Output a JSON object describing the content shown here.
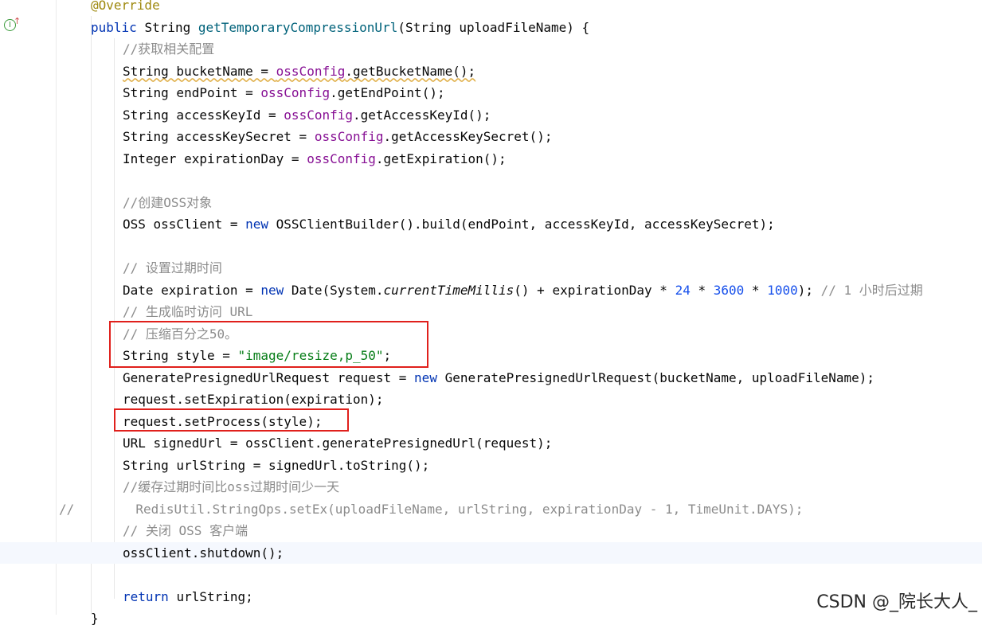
{
  "editor": {
    "lines": [
      [
        [
          "ann",
          "@Override"
        ]
      ],
      [
        [
          "kw",
          "public "
        ],
        [
          "",
          "String "
        ],
        [
          "fn",
          "getTemporaryCompressionUrl"
        ],
        [
          "",
          "(String uploadFileName) {"
        ]
      ],
      [
        [
          "cmt",
          "//获取相关配置"
        ]
      ],
      [
        [
          "warn",
          "String bucketName = "
        ],
        [
          "fld warn",
          "ossConfig"
        ],
        [
          "warn",
          ".getBucketName();"
        ]
      ],
      [
        [
          "",
          "String endPoint = "
        ],
        [
          "fld",
          "ossConfig"
        ],
        [
          "",
          ".getEndPoint();"
        ]
      ],
      [
        [
          "",
          "String accessKeyId = "
        ],
        [
          "fld",
          "ossConfig"
        ],
        [
          "",
          ".getAccessKeyId();"
        ]
      ],
      [
        [
          "",
          "String accessKeySecret = "
        ],
        [
          "fld",
          "ossConfig"
        ],
        [
          "",
          ".getAccessKeySecret();"
        ]
      ],
      [
        [
          "",
          "Integer expirationDay = "
        ],
        [
          "fld",
          "ossConfig"
        ],
        [
          "",
          ".getExpiration();"
        ]
      ],
      [],
      [
        [
          "cmt",
          "//创建OSS对象"
        ]
      ],
      [
        [
          "",
          "OSS ossClient = "
        ],
        [
          "kw",
          "new "
        ],
        [
          "",
          "OSSClientBuilder().build(endPoint, accessKeyId, accessKeySecret);"
        ]
      ],
      [],
      [
        [
          "cmt",
          "// 设置过期时间"
        ]
      ],
      [
        [
          "",
          "Date expiration = "
        ],
        [
          "kw",
          "new "
        ],
        [
          "",
          "Date(System."
        ],
        [
          "it",
          "currentTimeMillis"
        ],
        [
          "",
          "() + expirationDay * "
        ],
        [
          "num",
          "24"
        ],
        [
          "",
          " * "
        ],
        [
          "num",
          "3600"
        ],
        [
          "",
          " * "
        ],
        [
          "num",
          "1000"
        ],
        [
          "",
          "); "
        ],
        [
          "cmt",
          "// 1 小时后过期"
        ]
      ],
      [
        [
          "cmt",
          "// 生成临时访问 URL"
        ]
      ],
      [
        [
          "cmt",
          "// 压缩百分之50。"
        ]
      ],
      [
        [
          "",
          "String style = "
        ],
        [
          "str",
          "\"image/resize,p_50\""
        ],
        [
          "",
          ";"
        ]
      ],
      [
        [
          "",
          "GeneratePresignedUrlRequest request = "
        ],
        [
          "kw",
          "new "
        ],
        [
          "",
          "GeneratePresignedUrlRequest(bucketName, uploadFileName);"
        ]
      ],
      [
        [
          "",
          "request.setExpiration(expiration);"
        ]
      ],
      [
        [
          "",
          "request.setProcess(style);"
        ]
      ],
      [
        [
          "",
          "URL signedUrl = ossClient.generatePresignedUrl(request);"
        ]
      ],
      [
        [
          "",
          "String urlString = signedUrl.toString();"
        ]
      ],
      [
        [
          "cmt",
          "//缓存过期时间比oss过期时间少一天"
        ]
      ],
      [
        [
          "cmt",
          "//        RedisUtil.StringOps.setEx(uploadFileName, urlString, expirationDay - 1, TimeUnit.DAYS);"
        ]
      ],
      [
        [
          "cmt",
          "// 关闭 OSS 客户端"
        ]
      ],
      [
        [
          "",
          "ossClient.shutdown();"
        ]
      ],
      [],
      [
        [
          "kw",
          "return "
        ],
        [
          "",
          "urlString;"
        ]
      ],
      [
        [
          "",
          "}"
        ]
      ]
    ],
    "indents": [
      114,
      114,
      154,
      154,
      154,
      154,
      154,
      154,
      154,
      154,
      154,
      154,
      154,
      154,
      154,
      154,
      154,
      154,
      154,
      154,
      154,
      154,
      154,
      74,
      154,
      154,
      154,
      154,
      114
    ],
    "current_line": 25
  },
  "gutter": {
    "implements_icon": "implements-method-icon",
    "icon_glyph": "I",
    "arrow_glyph": "↑"
  },
  "watermark": "CSDN @_院长大人_",
  "colors": {
    "keyword": "#0033b3",
    "method": "#00627a",
    "field": "#871094",
    "string": "#067d17",
    "number": "#1750eb",
    "comment": "#8c8c8c",
    "annotation": "#9e880d",
    "highlight_box": "#e0201c"
  }
}
